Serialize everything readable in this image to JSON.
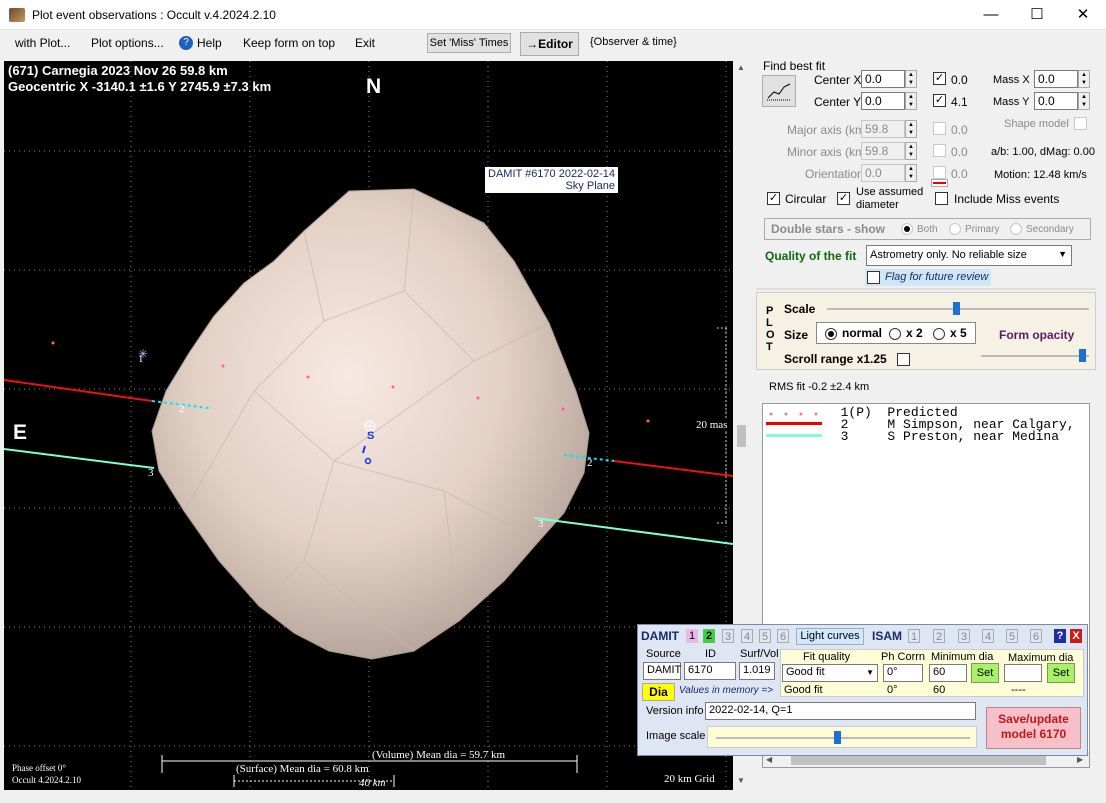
{
  "window": {
    "title": "Plot event observations : Occult v.4.2024.2.10",
    "minimize": "—",
    "maximize": "☐",
    "close": "✕"
  },
  "menu": {
    "with_plot": "with Plot...",
    "plot_options": "Plot options...",
    "help": "Help",
    "keep_form": "Keep form on top",
    "exit": "Exit",
    "set_miss": "Set 'Miss' Times",
    "editor": "→Editor",
    "observer_time": "{Observer & time}"
  },
  "plot": {
    "header1": "(671) Carnegia  2023 Nov 26  59.8 km",
    "header2": "Geocentric  X  -3140.1 ±1.6  Y 2745.9 ±7.3 km",
    "north": "N",
    "east": "E",
    "damit_label": "DAMIT #6170 2022-02-14",
    "sky_plane": "Sky Plane",
    "scale_mas": "20 mas",
    "vol_dia": "(Volume) Mean dia = 59.7 km",
    "surf_dia": "(Surface) Mean dia = 60.8 km",
    "km40": "40 km",
    "phase": "Phase offset 0°",
    "version": "Occult 4.2024.2.10",
    "grid": "20 km Grid",
    "chord_label_1": "1",
    "chord_label_2": "2",
    "chord_label_3": "3",
    "center_s": "S"
  },
  "fit": {
    "find_best_fit": "Find best fit",
    "center_x_label": "Center X",
    "center_x": "0.0",
    "center_y_label": "Center Y",
    "center_y": "0.0",
    "cx_check": "0.0",
    "cy_check": "4.1",
    "mass_x_label": "Mass X",
    "mass_x": "0.0",
    "mass_y_label": "Mass Y",
    "mass_y": "0.0",
    "shape_model": "Shape model",
    "major_label": "Major axis (km)",
    "major": "59.8",
    "major_chk": "0.0",
    "minor_label": "Minor axis (km)",
    "minor": "59.8",
    "minor_chk": "0.0",
    "orient_label": "Orientation",
    "orient": "0.0",
    "orient_chk": "0.0",
    "ab": "a/b: 1.00, dMag: 0.00",
    "motion": "Motion: 12.48 km/s",
    "circular": "Circular",
    "use_assumed": "Use assumed",
    "diameter": "diameter",
    "include_miss": "Include Miss events",
    "double_stars": "Double stars - show",
    "both": "Both",
    "primary": "Primary",
    "secondary": "Secondary",
    "quality_label": "Quality of the fit",
    "quality_value": "Astrometry only. No reliable size",
    "flag_review": "Flag for future review"
  },
  "plotctl": {
    "plot_letters": "P L O T",
    "scale": "Scale",
    "size": "Size",
    "normal": "normal",
    "x2": "x 2",
    "x5": "x 5",
    "form_opacity": "Form opacity",
    "scroll_range": "Scroll range x1.25",
    "rms": "RMS fit -0.2 ±2.4 km"
  },
  "legend": {
    "rows": [
      {
        "text": "  1(P)  Predicted",
        "color": "#ff6fb0",
        "style": "dots"
      },
      {
        "text": "  2     M Simpson, near Calgary,",
        "color": "#ee0000",
        "style": "line"
      },
      {
        "text": "  3     S Preston, near Medina",
        "color": "#7fffd4",
        "style": "line"
      }
    ]
  },
  "damit": {
    "damit": "DAMIT",
    "n1": "1",
    "n2": "2",
    "n3": "3",
    "n4": "4",
    "n5": "5",
    "n6": "6",
    "light_curves": "Light curves",
    "isam": "ISAM",
    "i1": "1",
    "i2": "2",
    "i3": "3",
    "i4": "4",
    "i5": "5",
    "i6": "6",
    "help": "?",
    "close": "X",
    "source_h": "Source",
    "id_h": "ID",
    "surf_h": "Surf/Vol",
    "source": "DAMIT",
    "id": "6170",
    "surf": "1.019",
    "fitq_h": "Fit quality",
    "phcorr_h": "Ph Corrn",
    "mindia_h": "Minimum dia",
    "maxdia_h": "Maximum dia",
    "fitq": "Good fit",
    "phcorr": "0°",
    "mindia": "60",
    "set1": "Set",
    "set2": "Set",
    "dia": "Dia",
    "values_mem": "Values in memory =>",
    "mem_fitq": "Good fit",
    "mem_ph": "0°",
    "mem_min": "60",
    "mem_max": "----",
    "version_label": "Version info",
    "version": "2022-02-14, Q=1",
    "image_scale": "Image scale",
    "save": "Save/update model 6170"
  }
}
